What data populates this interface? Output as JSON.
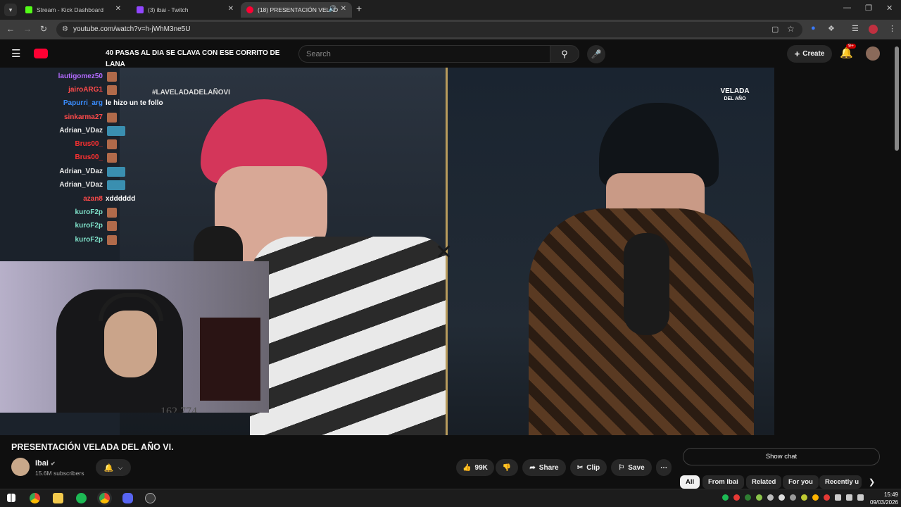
{
  "browser": {
    "tabs": [
      {
        "title": "Stream - Kick Dashboard",
        "color": "#53fc18"
      },
      {
        "title": "(3) ibai - Twitch",
        "color": "#9146ff"
      },
      {
        "title": "(18) PRESENTACIÓN VELAD",
        "color": "#ff0033",
        "active": true
      }
    ],
    "new_tab": "+",
    "url": "youtube.com/watch?v=h-jWhM3ne5U"
  },
  "youtube": {
    "search_placeholder": "Search",
    "create_label": "Create",
    "notif_badge": "9+"
  },
  "video": {
    "overlay_text": "#LAVELADADELAÑOVI",
    "logo_text": "VELADA",
    "logo_sub": "DEL AÑO",
    "pinned_message": "40 PASAS AL DIA SE CLAVA CON ESE CORRITO DE LANA",
    "bottom_counter": "162.774",
    "chat": [
      {
        "user": "lautigomez50",
        "color": "#b36bff",
        "msg": ""
      },
      {
        "user": "jairoARG1",
        "color": "#ff4a4a",
        "msg": ""
      },
      {
        "user": "Papurri_arg",
        "color": "#3a8dff",
        "msg": "le hizo un te follo"
      },
      {
        "user": "sinkarma27",
        "color": "#ff4a4a",
        "msg": ""
      },
      {
        "user": "Adrian_VDaz",
        "color": "#e8e8e8",
        "msg": ""
      },
      {
        "user": "Brus00_",
        "color": "#ff3030",
        "msg": ""
      },
      {
        "user": "Brus00_",
        "color": "#ff3030",
        "msg": ""
      },
      {
        "user": "Adrian_VDaz",
        "color": "#e8e8e8",
        "msg": ""
      },
      {
        "user": "Adrian_VDaz",
        "color": "#e8e8e8",
        "msg": ""
      },
      {
        "user": "azan8",
        "color": "#ff4a4a",
        "msg": "xdddddd"
      },
      {
        "user": "kuroF2p",
        "color": "#7ee0c8",
        "msg": ""
      },
      {
        "user": "kuroF2p",
        "color": "#7ee0c8",
        "msg": ""
      },
      {
        "user": "kuroF2p",
        "color": "#7ee0c8",
        "msg": ""
      }
    ]
  },
  "info": {
    "title": "PRESENTACIÓN VELADA DEL AÑO VI.",
    "channel": "Ibai",
    "subscribers": "15.6M subscribers",
    "likes": "99K",
    "share": "Share",
    "clip": "Clip",
    "save": "Save",
    "show_chat": "Show chat"
  },
  "chips": [
    "All",
    "From Ibai",
    "Related",
    "For you",
    "Recently u"
  ],
  "taskbar": {
    "time": "15:49",
    "date": "09/03/2026"
  }
}
